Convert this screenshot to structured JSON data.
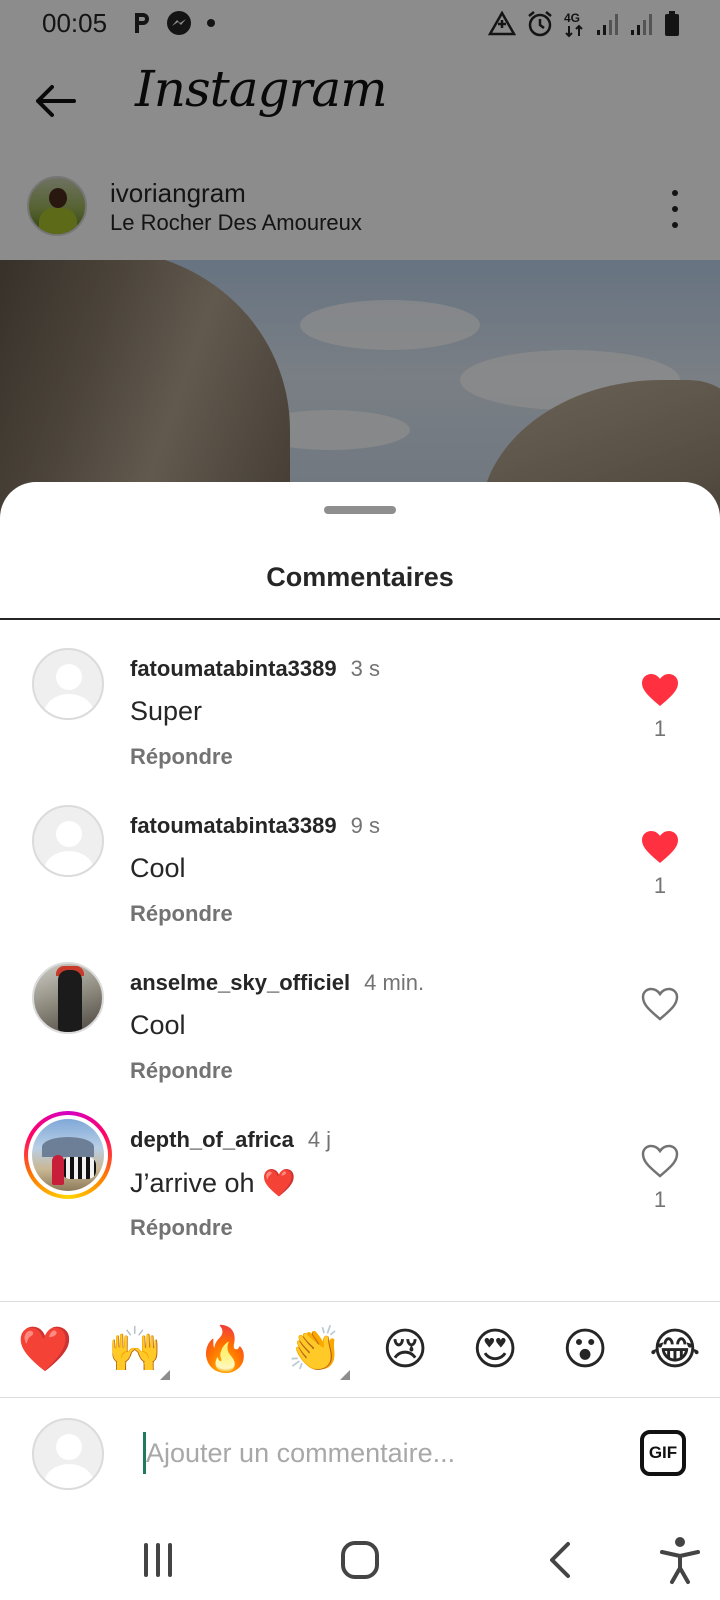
{
  "status_bar": {
    "time": "00:05",
    "left_icons": [
      "parking-icon",
      "messenger-icon",
      "dot-icon"
    ],
    "right_icons": [
      "data-saver-icon",
      "alarm-icon",
      "4g-icon",
      "signal-icon",
      "signal-icon",
      "battery-icon"
    ],
    "network": "4G"
  },
  "header": {
    "brand": "Instagram"
  },
  "post": {
    "username": "ivoriangram",
    "location": "Le Rocher Des Amoureux"
  },
  "sheet": {
    "title": "Commentaires"
  },
  "comments": [
    {
      "username": "fatoumatabinta3389",
      "time": "3 s",
      "text": "Super",
      "reply_label": "Répondre",
      "liked": true,
      "likes": "1"
    },
    {
      "username": "fatoumatabinta3389",
      "time": "9 s",
      "text": "Cool",
      "reply_label": "Répondre",
      "liked": true,
      "likes": "1"
    },
    {
      "username": "anselme_sky_officiel",
      "time": "4 min.",
      "text": "Cool",
      "reply_label": "Répondre",
      "liked": false,
      "likes": ""
    },
    {
      "username": "depth_of_africa",
      "time": "4 j",
      "text": "J’arrive oh ❤️",
      "reply_label": "Répondre",
      "liked": false,
      "likes": "1"
    }
  ],
  "emoji_bar": [
    "❤️",
    "🙌",
    "🔥",
    "👏",
    "😢",
    "😍",
    "😮",
    "😂"
  ],
  "composer": {
    "placeholder": "Ajouter un commentaire...",
    "gif_label": "GIF"
  },
  "colors": {
    "like_red": "#ff3040",
    "text_primary": "#262626",
    "text_secondary": "#737373",
    "caret": "#1e7b5c"
  },
  "nav": [
    "recent-apps-icon",
    "home-icon",
    "back-icon",
    "accessibility-icon"
  ]
}
